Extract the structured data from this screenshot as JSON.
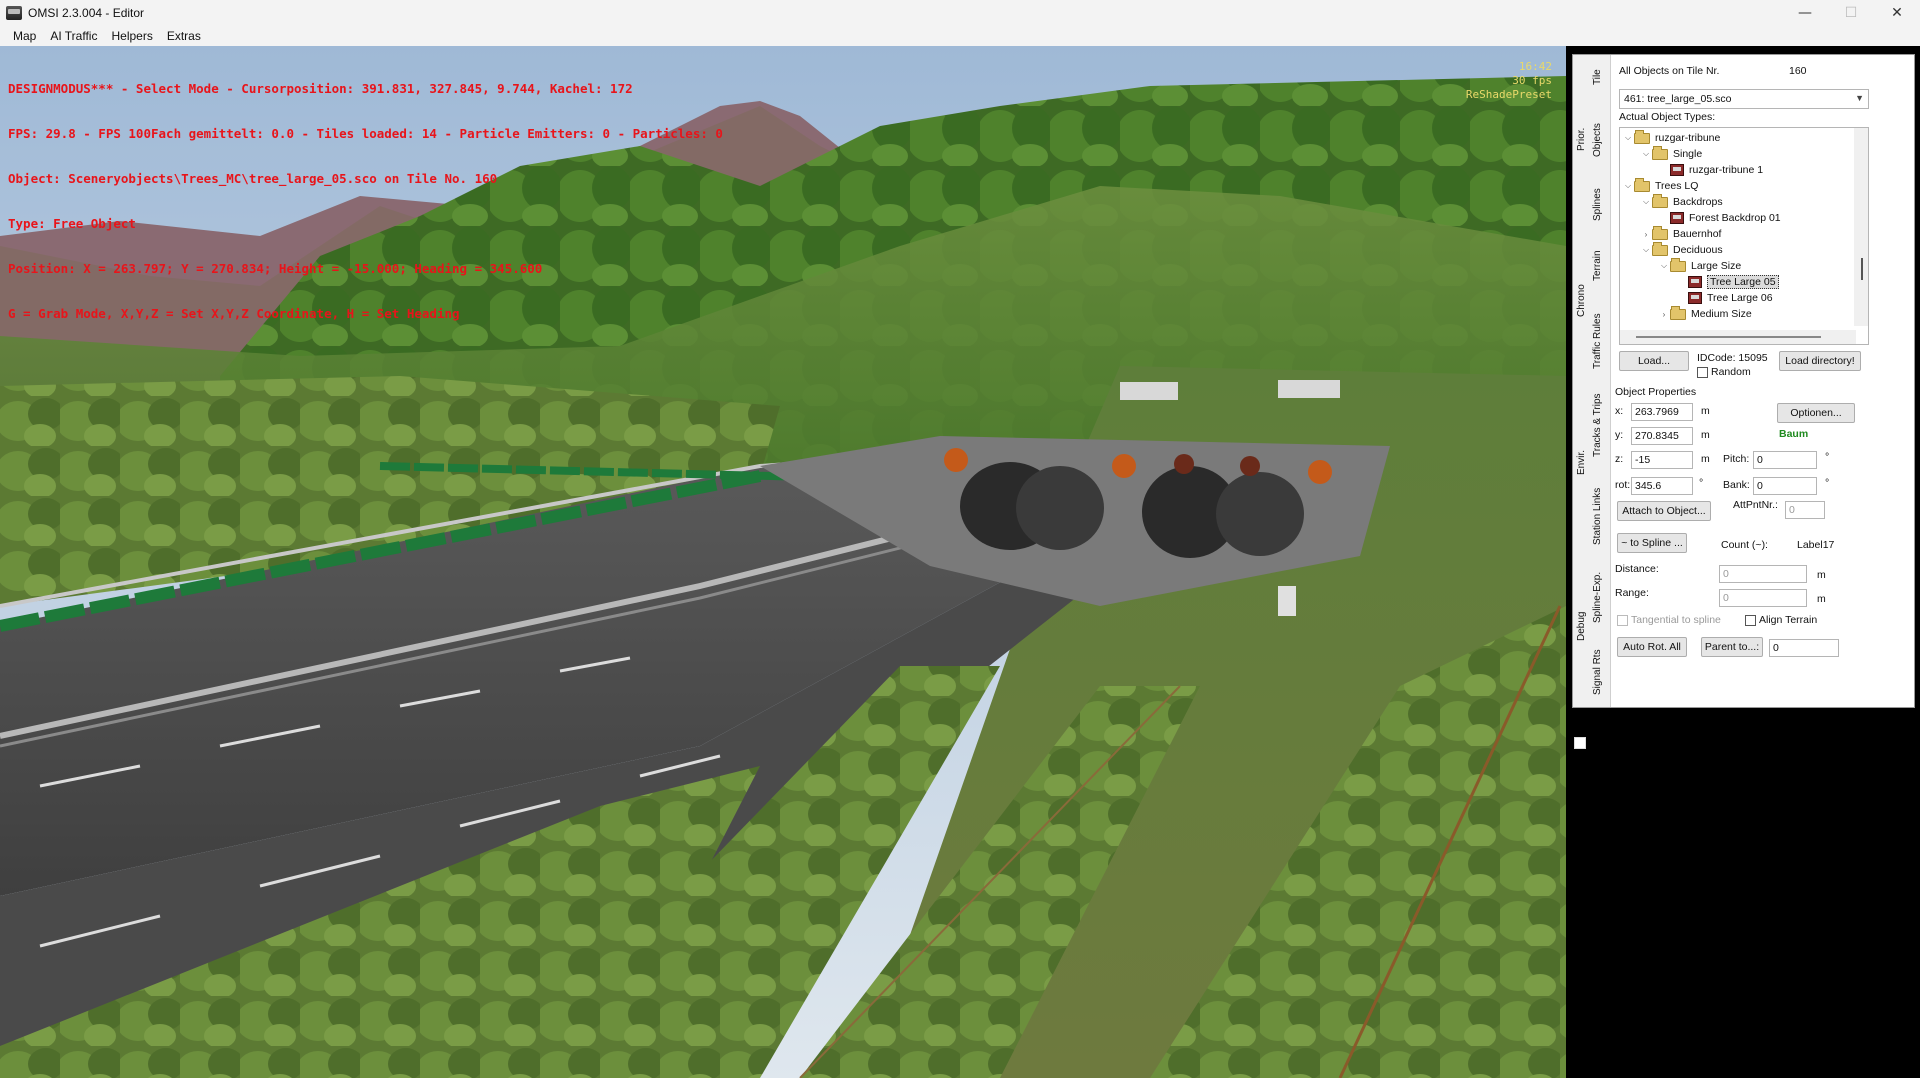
{
  "window": {
    "title": "OMSI 2.3.004 - Editor",
    "minimize": "—",
    "maximize": "☐",
    "close": "✕"
  },
  "menu": [
    "Map",
    "AI Traffic",
    "Helpers",
    "Extras"
  ],
  "hud": {
    "lines": [
      "DESIGNMODUS*** - Select Mode - Cursorposition: 391.831, 327.845, 9.744, Kachel: 172",
      "FPS: 29.8 - FPS 100Fach gemittelt: 0.0 - Tiles loaded: 14 - Particle Emitters: 0 - Particles: 0",
      "Object: Sceneryobjects\\Trees_MC\\tree_large_05.sco on Tile No. 160",
      "Type: Free Object",
      "Position: X = 263.797; Y = 270.834; Height = -15.000; Heading = 345.600",
      "G = Grab Mode, X,Y,Z = Set X,Y,Z Coordinate, H = Set Heading"
    ],
    "time": "16:42",
    "fps": "30 fps",
    "preset": "ReShadePreset",
    "color": "#e8141a"
  },
  "side_tabs": [
    "Tile",
    "Objects",
    "Prior.",
    "Splines",
    "Terrain",
    "Chrono",
    "Traffic Rules",
    "Tracks & Trips",
    "Envir.",
    "Station Links",
    "Spline-Exp.",
    "Debug",
    "Signal Rts"
  ],
  "panel": {
    "all_objects_label": "All Objects on Tile Nr.",
    "tile_nr": "160",
    "selected_object": "461: tree_large_05.sco",
    "actual_types_label": "Actual Object Types:",
    "tree": [
      {
        "label": "ruzgar-tribune",
        "type": "folder",
        "expanded": true
      },
      {
        "label": "Single",
        "type": "folder",
        "expanded": true
      },
      {
        "label": "ruzgar-tribune 1",
        "type": "object"
      },
      {
        "label": "Trees LQ",
        "type": "folder",
        "expanded": true
      },
      {
        "label": "Backdrops",
        "type": "folder",
        "expanded": true
      },
      {
        "label": "Forest Backdrop 01",
        "type": "object"
      },
      {
        "label": "Bauernhof",
        "type": "folder",
        "expanded": false
      },
      {
        "label": "Deciduous",
        "type": "folder",
        "expanded": true
      },
      {
        "label": "Large Size",
        "type": "folder",
        "expanded": true
      },
      {
        "label": "Tree Large 05",
        "type": "object",
        "selected": true
      },
      {
        "label": "Tree Large 06",
        "type": "object"
      },
      {
        "label": "Medium Size",
        "type": "folder",
        "expanded": false
      }
    ],
    "load_button": "Load...",
    "idcode": "IDCode: 15095",
    "random_label": "Random",
    "load_directory_button": "Load directory!",
    "object_properties_label": "Object Properties",
    "x_label": "x:",
    "x_value": "263.7969",
    "y_label": "y:",
    "y_value": "270.8345",
    "z_label": "z:",
    "z_value": "-15",
    "rot_label": "rot:",
    "rot_value": "345.6",
    "unit_m": "m",
    "unit_deg": "°",
    "optionen_button": "Optionen...",
    "object_kind": "Baum",
    "object_kind_color": "#1f8a1f",
    "pitch_label": "Pitch:",
    "pitch_value": "0",
    "bank_label": "Bank:",
    "bank_value": "0",
    "attach_button": "Attach to Object...",
    "attpntnr_label": "AttPntNr.:",
    "attpntnr_value": "0",
    "to_spline_button": "~ to Spline ...",
    "count_label": "Count (~):",
    "label17": "Label17",
    "distance_label": "Distance:",
    "distance_value": "0",
    "range_label": "Range:",
    "range_value": "0",
    "tangential_label": "Tangential to spline",
    "align_terrain_label": "Align Terrain",
    "auto_rot_button": "Auto Rot. All",
    "parent_to_button": "Parent to...:",
    "parent_value": "0"
  }
}
